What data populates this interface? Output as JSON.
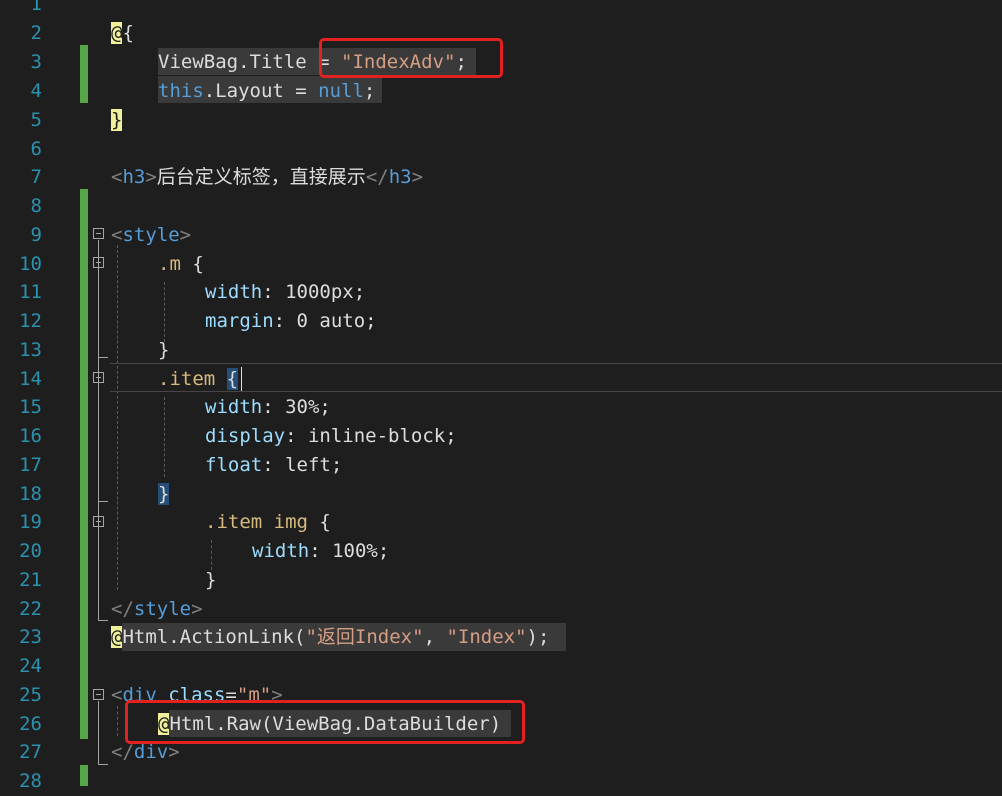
{
  "editor": {
    "line_numbers": [
      "1",
      "2",
      "3",
      "4",
      "5",
      "6",
      "7",
      "8",
      "9",
      "10",
      "11",
      "12",
      "13",
      "14",
      "15",
      "16",
      "17",
      "18",
      "19",
      "20",
      "21",
      "22",
      "23",
      "24",
      "25",
      "26",
      "27",
      "28"
    ],
    "colors": {
      "background": "#1e1e1e",
      "line_number": "#2b91af",
      "modified_marker": "#57a64a",
      "highlight_box": "#e3211f",
      "string": "#d69d85",
      "keyword": "#569cd6",
      "css_property": "#9cdcfe",
      "css_selector": "#d7ba7d"
    },
    "code": {
      "l2_at": "@",
      "l2_brace": "{",
      "l3_obj": "ViewBag.",
      "l3_prop": "Title",
      "l3_eq": " = ",
      "l3_str": "\"IndexAdv\"",
      "l3_semi": ";",
      "l4_this": "this",
      "l4_rest": ".Layout = ",
      "l4_null": "null",
      "l4_semi": ";",
      "l5_brace": "}",
      "l7_open_lt": "<",
      "l7_open_tag": "h3",
      "l7_open_gt": ">",
      "l7_text": "后台定义标签，直接展示",
      "l7_close_lt": "</",
      "l7_close_tag": "h3",
      "l7_close_gt": ">",
      "l9_lt": "<",
      "l9_tag": "style",
      "l9_gt": ">",
      "l10_sel": ".m",
      "l10_brace": " {",
      "l11_prop": "width",
      "l11_val": ": 1000px;",
      "l12_prop": "margin",
      "l12_val": ": 0 auto;",
      "l13_brace": "}",
      "l14_sel": ".item",
      "l14_sp": " ",
      "l14_brace": "{",
      "l15_prop": "width",
      "l15_val": ": 30%;",
      "l16_prop": "display",
      "l16_val": ": inline-block;",
      "l17_prop": "float",
      "l17_val": ": left;",
      "l18_brace": "}",
      "l19_sel": ".item img",
      "l19_brace": " {",
      "l20_prop": "width",
      "l20_val": ": 100%;",
      "l21_brace": "}",
      "l22_lt": "</",
      "l22_tag": "style",
      "l22_gt": ">",
      "l23_at": "@",
      "l23_call": "Html.ActionLink(",
      "l23_str1": "\"返回Index\"",
      "l23_comma": ", ",
      "l23_str2": "\"Index\"",
      "l23_end": ");",
      "l25_lt": "<",
      "l25_tag": "div",
      "l25_attr": " class",
      "l25_eq": "=",
      "l25_val": "\"m\"",
      "l25_gt": ">",
      "l26_at": "@",
      "l26_call": "Html.Raw(ViewBag.DataBuilder)",
      "l27_lt": "</",
      "l27_tag": "div",
      "l27_gt": ">"
    }
  }
}
